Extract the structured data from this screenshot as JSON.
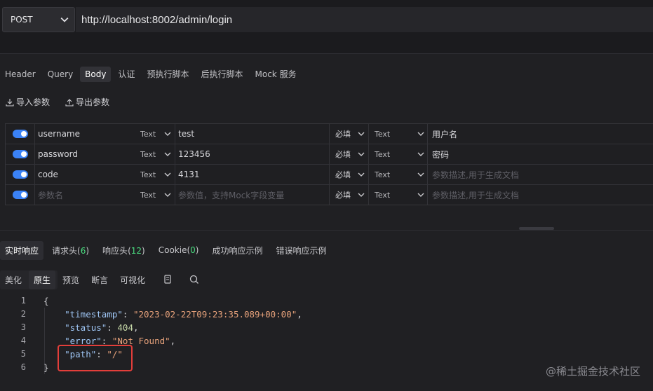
{
  "request": {
    "method": "POST",
    "url": "http://localhost:8002/admin/login"
  },
  "request_tabs": [
    "Header",
    "Query",
    "Body",
    "认证",
    "预执行脚本",
    "后执行脚本",
    "Mock 服务"
  ],
  "active_request_tab": "Body",
  "tools": {
    "import_label": "导入参数",
    "export_label": "导出参数"
  },
  "params": [
    {
      "name": "username",
      "type": "Text",
      "value": "test",
      "required": "必填",
      "value_type": "Text",
      "desc": "用户名"
    },
    {
      "name": "password",
      "type": "Text",
      "value": "123456",
      "required": "必填",
      "value_type": "Text",
      "desc": "密码"
    },
    {
      "name": "code",
      "type": "Text",
      "value": "4131",
      "required": "必填",
      "value_type": "Text",
      "desc": ""
    },
    {
      "name": "",
      "type": "Text",
      "value": "",
      "required": "必填",
      "value_type": "Text",
      "desc": ""
    }
  ],
  "placeholders": {
    "name": "参数名",
    "value": "参数值，支持Mock字段变量",
    "desc": "参数描述,用于生成文档"
  },
  "response_tabs": {
    "realtime": "实时响应",
    "req_headers": "请求头",
    "req_headers_count": "6",
    "resp_headers": "响应头",
    "resp_headers_count": "12",
    "cookie": "Cookie",
    "cookie_count": "0",
    "success_example": "成功响应示例",
    "error_example": "错误响应示例"
  },
  "view_tabs": [
    "美化",
    "原生",
    "预览",
    "断言",
    "可视化"
  ],
  "active_view_tab": "原生",
  "response_body": {
    "line_numbers": [
      "1",
      "2",
      "3",
      "4",
      "5",
      "6"
    ],
    "open_brace": "{",
    "close_brace": "}",
    "timestamp_key": "\"timestamp\"",
    "timestamp_value": "\"2023-02-22T09:23:35.089+00:00\"",
    "status_key": "\"status\"",
    "status_value": "404",
    "error_key": "\"error\"",
    "error_value": "\"Not Found\"",
    "path_key": "\"path\"",
    "path_value": "\"/\""
  },
  "watermark": "@稀土掘金技术社区",
  "colors": {
    "accent": "#3b82f6",
    "highlight_box": "#e33e3a",
    "count_green": "#4ade80"
  }
}
